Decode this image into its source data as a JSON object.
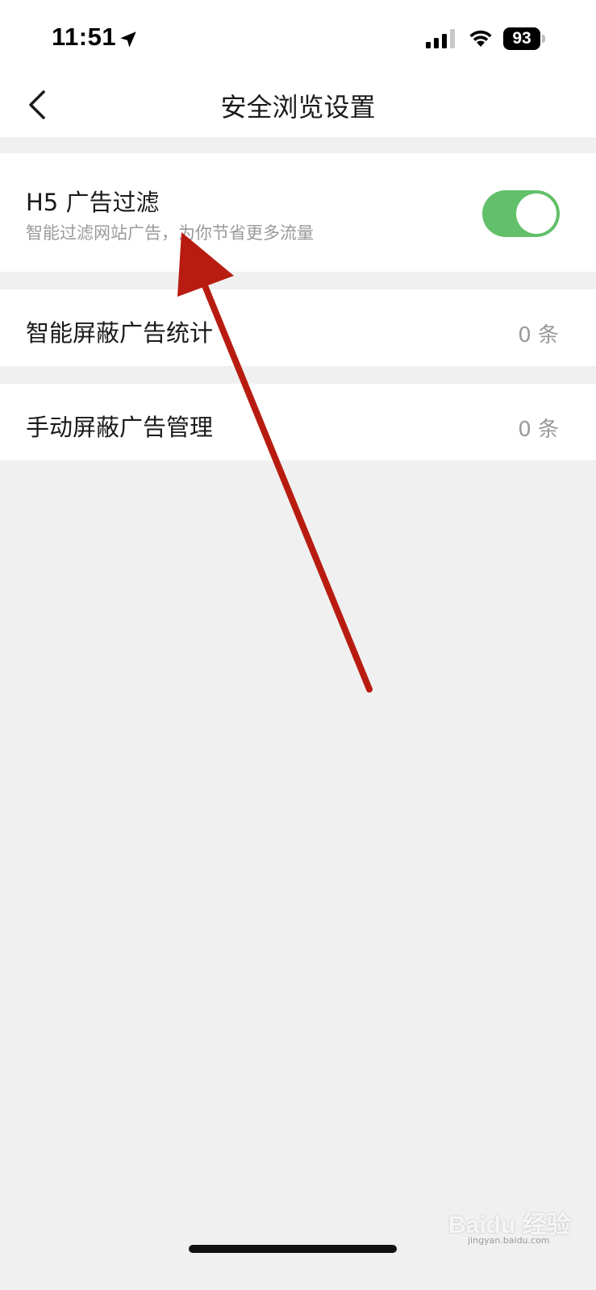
{
  "status_bar": {
    "time": "11:51",
    "battery": "93",
    "icons": [
      "location-arrow-icon",
      "cellular-signal-icon",
      "wifi-icon",
      "battery-icon"
    ]
  },
  "nav": {
    "title": "安全浏览设置",
    "back_icon": "chevron-left-icon"
  },
  "settings": {
    "h5_filter": {
      "title": "H5 广告过滤",
      "subtitle": "智能过滤网站广告，为你节省更多流量",
      "enabled": true
    },
    "smart_block": {
      "title": "智能屏蔽广告统计",
      "value": "0 条"
    },
    "manual_block": {
      "title": "手动屏蔽广告管理",
      "value": "0 条"
    }
  },
  "annotation": {
    "arrow_color": "#b81c10"
  },
  "watermark": {
    "text": "Baidu 经验",
    "sub": "jingyan.baidu.com"
  },
  "colors": {
    "toggle_on": "#62c06a",
    "page_bg": "#f0f0f0"
  }
}
